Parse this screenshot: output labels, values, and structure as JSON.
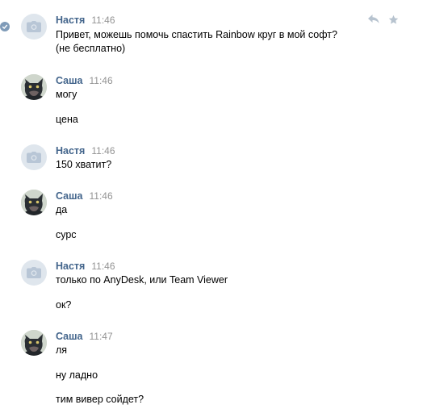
{
  "colors": {
    "author": "#42648b",
    "time": "#939393",
    "avatar_placeholder": "#dfe6ed",
    "avatar_camera": "#b8c6d6",
    "check": "#7f9bb8",
    "action_icon": "#b7c3cf"
  },
  "messages": [
    {
      "author": "Настя",
      "time": "11:46",
      "avatar": "camera-placeholder",
      "lines": [
        "Привет, можешь помочь спастить Rainbow круг в мой софт?",
        "(не бесплатно)"
      ]
    },
    {
      "author": "Саша",
      "time": "11:46",
      "avatar": "cat-photo",
      "lines": [
        "могу",
        "цена"
      ]
    },
    {
      "author": "Настя",
      "time": "11:46",
      "avatar": "camera-placeholder",
      "lines": [
        "150 хватит?"
      ]
    },
    {
      "author": "Саша",
      "time": "11:46",
      "avatar": "cat-photo",
      "lines": [
        "да",
        "сурс"
      ]
    },
    {
      "author": "Настя",
      "time": "11:46",
      "avatar": "camera-placeholder",
      "lines": [
        "только по AnyDesk, или Team Viewer",
        "ок?"
      ]
    },
    {
      "author": "Саша",
      "time": "11:47",
      "avatar": "cat-photo",
      "lines": [
        "ля",
        "ну ладно",
        "тим вивер сойдет?"
      ]
    }
  ],
  "icons": {
    "selected": "check-circle-icon",
    "reply": "reply-icon",
    "favorite": "star-icon",
    "placeholder": "camera-icon"
  }
}
